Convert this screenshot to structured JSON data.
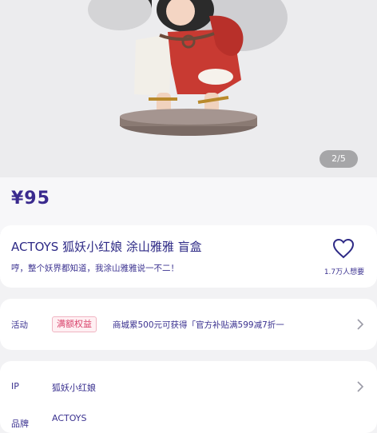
{
  "gallery": {
    "indicator": "2/5"
  },
  "product": {
    "price": "¥95",
    "title": "ACTOYS 狐妖小红娘 涂山雅雅 盲盒",
    "subtitle": "哼，整个妖界都知道，我涂山雅雅说一不二！",
    "favorite_count": "1.7万人想要"
  },
  "activity": {
    "label": "活动",
    "badge": "满额权益",
    "text": "商城累500元可获得「官方补贴满599减7折一"
  },
  "specs": {
    "ip_label": "IP",
    "ip_value": "狐妖小红娘",
    "brand_label": "品牌",
    "brand_value": "ACTOYS"
  },
  "colors": {
    "accent": "#2e2a86",
    "badge": "#d8416a",
    "background": "#f2f2f4"
  },
  "icons": [
    "heart-icon",
    "chevron-right-icon"
  ]
}
